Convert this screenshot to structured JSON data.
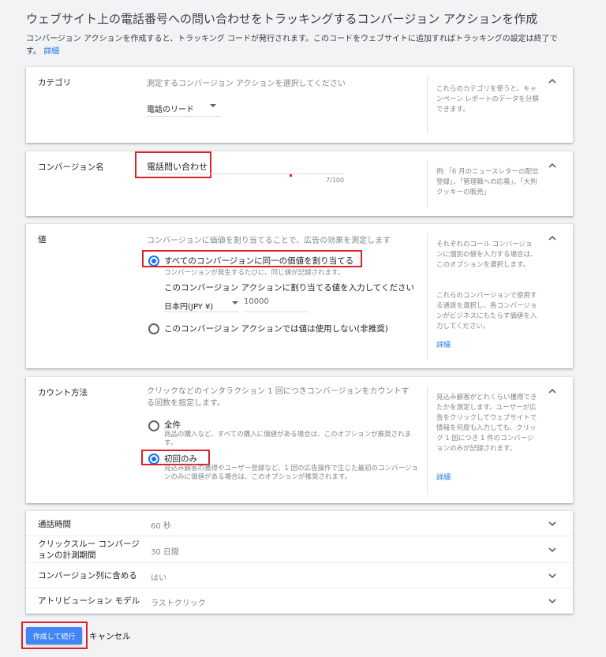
{
  "page": {
    "title": "ウェブサイト上の電話番号への問い合わせをトラッキングするコンバージョン アクションを作成",
    "intro": "コンバージョン アクションを作成すると、トラッキング コードが発行されます。このコードをウェブサイトに追加すればトラッキングの設定は終了で",
    "intro_line2": "す。",
    "intro_link": "詳細"
  },
  "category": {
    "label": "カテゴリ",
    "prompt": "測定するコンバージョン アクションを選択してください",
    "selected": "電話のリード",
    "hint": "これらのカテゴリを使うと、キャンペーン レポートのデータを分類できます。"
  },
  "conversion_name": {
    "label": "コンバージョン名",
    "value": "電話問い合わせ",
    "counter": "7/100",
    "hint": "例:「6 月のニュースレターの配信登録」、「管理職への応募」、「大判クッキーの販売」"
  },
  "value": {
    "label": "値",
    "prompt": "コンバージョンに価値を割り当てることで、広告の効果を測定します",
    "option_same": "すべてのコンバージョンに同一の価値を割り当てる",
    "option_same_desc": "コンバージョンが発生するたびに、同じ値が記録されます。",
    "enter_value_label": "このコンバージョン アクションに割り当てる値を入力してください",
    "currency": "日本円(JPY ¥)",
    "amount": "10000",
    "option_none": "このコンバージョン アクションでは値は使用しない(非推奨)",
    "hint1": "それぞれのコール コンバージョンに個別の値を入力する場合は、このオプションを選択します。",
    "hint2": "これらのコンバージョンで使用する通貨を選択し、各コンバージョンがビジネスにもたらす価値を入力してください。",
    "hint_link": "詳細"
  },
  "count": {
    "label": "カウント方法",
    "prompt": "クリックなどのインタラクション 1 回につきコンバージョンをカウントする回数を指定します。",
    "option_all": "全件",
    "option_all_desc": "商品の購入など、すべての購入に価値がある場合は、このオプションが推奨されます。",
    "option_first": "初回のみ",
    "option_first_desc": "見込み顧客の獲得やユーザー登録など、1 回の広告操作で生じた最初のコンバージョンのみに価値がある場合は、このオプションが推奨されます。",
    "hint": "見込み顧客がどれくらい獲得できたかを測定します。ユーザーが広告をクリックしてウェブサイトで情報を何度も入力しても、クリック 1 回につき 1 件のコンバージョンのみが記録されます。",
    "hint_link": "詳細"
  },
  "collapsed_rows": [
    {
      "label": "通話時間",
      "value": "60 秒"
    },
    {
      "label": "クリックスルー コンバージョンの計測期間",
      "value": "30 日間"
    },
    {
      "label": "コンバージョン列に含める",
      "value": "はい"
    },
    {
      "label": "アトリビューション モデル",
      "value": "ラストクリック"
    }
  ],
  "buttons": {
    "create": "作成して続行",
    "cancel": "キャンセル"
  },
  "colors": {
    "accent": "#1a73e8",
    "highlight": "#e0202a"
  }
}
